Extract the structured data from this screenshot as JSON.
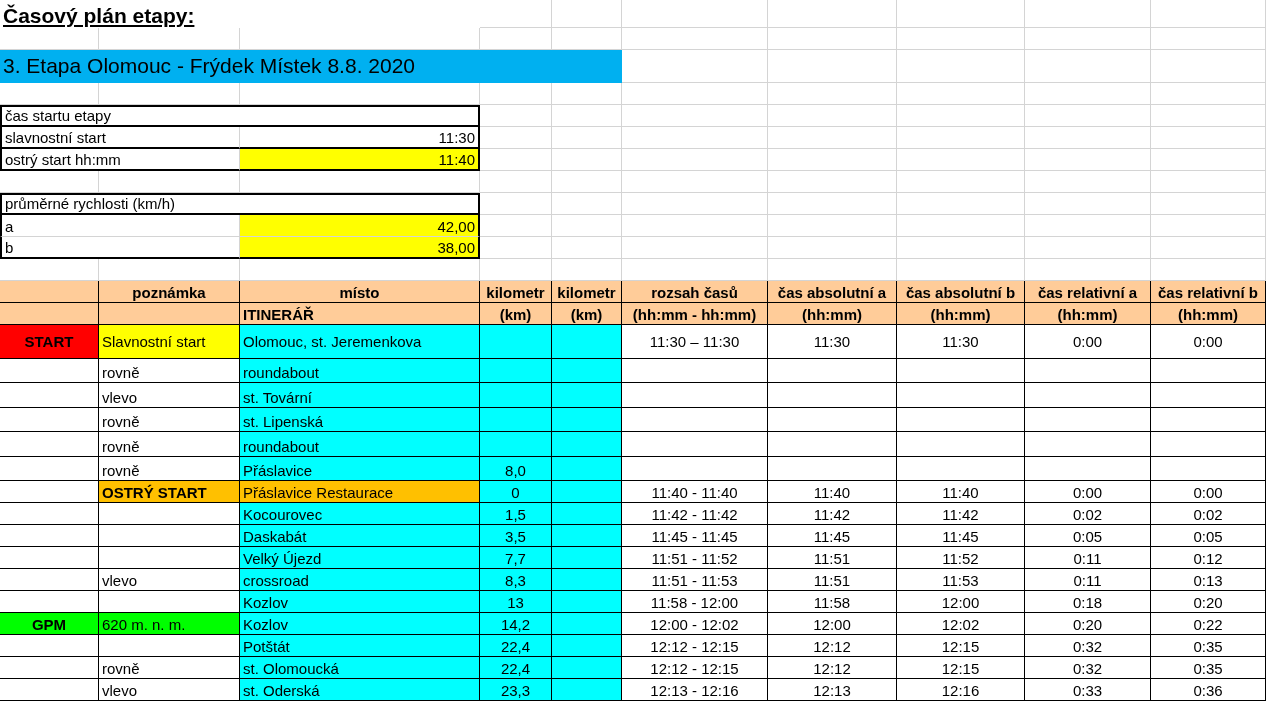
{
  "title": "Časový plán etapy:",
  "stage_banner": "3. Etapa Olomouc - Frýdek Místek 8.8. 2020",
  "start_times": {
    "header": "čas startu etapy",
    "rows": [
      {
        "label": "slavnostní start",
        "value": "11:30",
        "highlighted": false
      },
      {
        "label": "ostrý start hh:mm",
        "value": "11:40",
        "highlighted": true
      }
    ]
  },
  "speeds": {
    "header": "průměrné rychlosti (km/h)",
    "rows": [
      {
        "label": "a",
        "value": "42,00",
        "highlighted": true
      },
      {
        "label": "b",
        "value": "38,00",
        "highlighted": true
      }
    ]
  },
  "table": {
    "columns": [
      {},
      {
        "heading": "poznámka"
      },
      {
        "heading": "místo",
        "subheading": "ITINERÁŘ"
      },
      {
        "heading": "kilometr",
        "subheading": "(km)"
      },
      {
        "heading": "kilometr",
        "subheading": "(km)"
      },
      {
        "heading": "rozsah časů",
        "subheading": "(hh:mm - hh:mm)"
      },
      {
        "heading": "čas absolutní a",
        "subheading": "(hh:mm)"
      },
      {
        "heading": "čas absolutní b",
        "subheading": "(hh:mm)"
      },
      {
        "heading": "čas relativní a",
        "subheading": "(hh:mm)"
      },
      {
        "heading": "čas relativní b",
        "subheading": "(hh:mm)"
      }
    ],
    "rows": [
      {
        "kind": "start",
        "marker": "START",
        "note": "Slavnostní start",
        "place": "Olomouc, st. Jeremenkova",
        "time_range": "11:30 – 11:30",
        "abs_a": "11:30",
        "abs_b": "11:30",
        "rel_a": "0:00",
        "rel_b": "0:00"
      },
      {
        "kind": "waypoint",
        "note": "rovně",
        "place": "roundabout"
      },
      {
        "kind": "waypoint",
        "note": "vlevo",
        "place": "st. Tovární"
      },
      {
        "kind": "waypoint",
        "note": "rovně",
        "place": "st. Lipenská"
      },
      {
        "kind": "waypoint",
        "note": "rovně",
        "place": "roundabout"
      },
      {
        "kind": "waypoint",
        "note": "rovně",
        "place": "Přáslavice",
        "km": "8,0"
      },
      {
        "kind": "sharp_start",
        "note": "OSTRÝ START",
        "place": "Přáslavice Restaurace",
        "km": "0",
        "time_range": "11:40 - 11:40",
        "abs_a": "11:40",
        "abs_b": "11:40",
        "rel_a": "0:00",
        "rel_b": "0:00"
      },
      {
        "kind": "waypoint",
        "place": "Kocourovec",
        "km": "1,5",
        "time_range": "11:42 - 11:42",
        "abs_a": "11:42",
        "abs_b": "11:42",
        "rel_a": "0:02",
        "rel_b": "0:02"
      },
      {
        "kind": "waypoint",
        "place": "Daskabát",
        "km": "3,5",
        "time_range": "11:45 - 11:45",
        "abs_a": "11:45",
        "abs_b": "11:45",
        "rel_a": "0:05",
        "rel_b": "0:05"
      },
      {
        "kind": "waypoint",
        "place": "Velký Újezd",
        "km": "7,7",
        "time_range": "11:51 - 11:52",
        "abs_a": "11:51",
        "abs_b": "11:52",
        "rel_a": "0:11",
        "rel_b": "0:12"
      },
      {
        "kind": "waypoint",
        "note": "vlevo",
        "place": "crossroad",
        "km": "8,3",
        "time_range": "11:51 - 11:53",
        "abs_a": "11:51",
        "abs_b": "11:53",
        "rel_a": "0:11",
        "rel_b": "0:13"
      },
      {
        "kind": "waypoint",
        "place": "Kozlov",
        "km": "13",
        "time_range": "11:58 - 12:00",
        "abs_a": "11:58",
        "abs_b": "12:00",
        "rel_a": "0:18",
        "rel_b": "0:20"
      },
      {
        "kind": "climb",
        "marker": "GPM",
        "note": "620 m. n. m.",
        "place": "Kozlov",
        "km": "14,2",
        "time_range": "12:00 - 12:02",
        "abs_a": "12:00",
        "abs_b": "12:02",
        "rel_a": "0:20",
        "rel_b": "0:22"
      },
      {
        "kind": "waypoint",
        "place": "Potštát",
        "km": "22,4",
        "time_range": "12:12 - 12:15",
        "abs_a": "12:12",
        "abs_b": "12:15",
        "rel_a": "0:32",
        "rel_b": "0:35"
      },
      {
        "kind": "waypoint",
        "note": "rovně",
        "place": "st. Olomoucká",
        "km": "22,4",
        "time_range": "12:12 - 12:15",
        "abs_a": "12:12",
        "abs_b": "12:15",
        "rel_a": "0:32",
        "rel_b": "0:35"
      },
      {
        "kind": "waypoint",
        "note": "vlevo",
        "place": "st. Oderská",
        "km": "23,3",
        "time_range": "12:13 - 12:16",
        "abs_a": "12:13",
        "abs_b": "12:16",
        "rel_a": "0:33",
        "rel_b": "0:36"
      }
    ]
  }
}
